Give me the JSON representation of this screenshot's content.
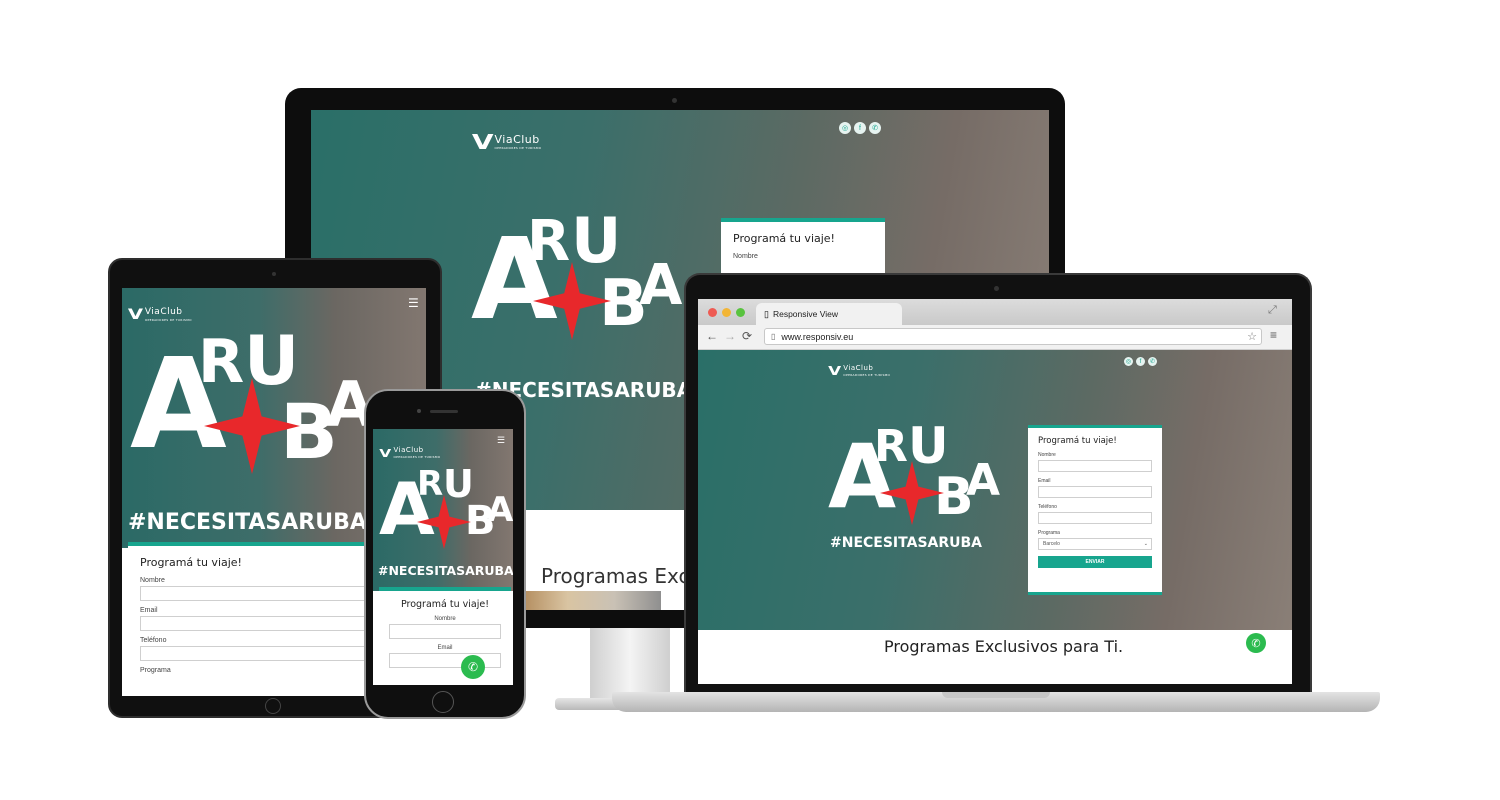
{
  "brand": {
    "name": "ViaClub",
    "tagline": "OPERADORES DE TURISMO"
  },
  "hero": {
    "letters": [
      "A",
      "R",
      "U",
      "B",
      "A"
    ],
    "hashtag": "#NECESITASARUBA"
  },
  "form": {
    "title": "Programá tu viaje!",
    "fields": {
      "name": "Nombre",
      "email": "Email",
      "phone": "Teléfono",
      "program": "Programa"
    },
    "program_selected": "Barcelo",
    "submit": "ENVIAR"
  },
  "section_title_full": "Programas Exclusivos para Ti.",
  "section_title_cut": "Programas Exclu",
  "browser": {
    "tab_title": "Responsive View",
    "url": "www.responsiv.eu"
  },
  "social_icons": [
    "instagram-icon",
    "facebook-icon",
    "whatsapp-icon"
  ],
  "colors": {
    "accent": "#17a58e",
    "whatsapp": "#2bbb4f",
    "star": "#e8282b"
  }
}
